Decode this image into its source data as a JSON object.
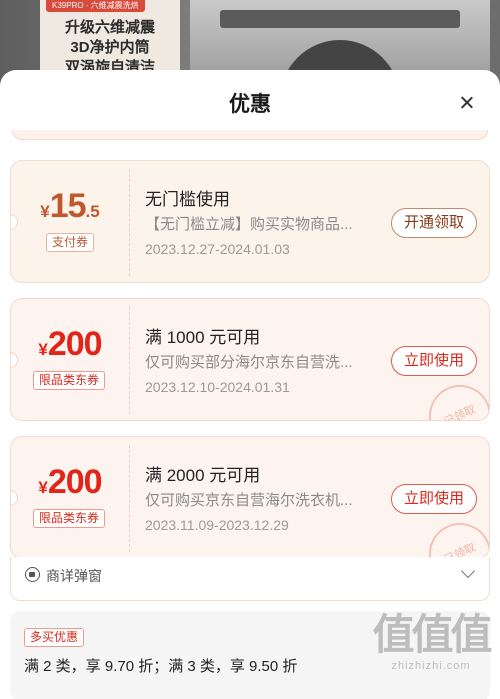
{
  "banner": {
    "tag": "K39PRO · 六维减震洗烘",
    "lines": [
      "升级六维减震",
      "3D净护内筒",
      "双涡旋自清洁"
    ]
  },
  "sheet": {
    "title": "优惠",
    "close_icon": "close-icon"
  },
  "coupons": [
    {
      "currency": "¥",
      "amount_int": "15",
      "amount_dec": ".5",
      "type": "支付券",
      "title": "无门槛使用",
      "desc": "【无门槛立减】购买实物商品...",
      "date": "2023.12.27-2024.01.03",
      "button": "开通领取",
      "stamp": ""
    },
    {
      "currency": "¥",
      "amount_int": "200",
      "amount_dec": "",
      "type": "限品类东券",
      "title": "满 1000 元可用",
      "desc": "仅可购买部分海尔京东自营洗...",
      "date": "2023.12.10-2024.01.31",
      "button": "立即使用",
      "stamp": "已领取"
    },
    {
      "currency": "¥",
      "amount_int": "200",
      "amount_dec": "",
      "type": "限品类东券",
      "title": "满 2000 元可用",
      "desc": "仅可购买京东自营海尔洗衣机...",
      "date": "2023.11.09-2023.12.29",
      "button": "立即使用",
      "stamp": "已领取"
    }
  ],
  "shop_popup": {
    "label": "商详弹窗",
    "icon": "shop-icon"
  },
  "promo": {
    "tag": "多买优惠",
    "text": "满 2 类，享 9.70 折；满 3 类，享 9.50 折"
  },
  "watermark": {
    "mark": "值值值",
    "url": "zhizhizhi.com"
  },
  "colors": {
    "accent_red": "#e1251b",
    "gold_coupon": "#c0572d"
  }
}
